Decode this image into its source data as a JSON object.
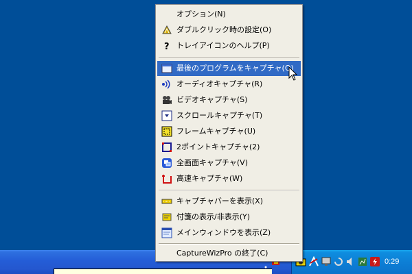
{
  "menu": {
    "items": [
      {
        "label": "オプション(N)",
        "icon": "none"
      },
      {
        "label": "ダブルクリック時の設定(O)",
        "icon": "double-click-icon"
      },
      {
        "label": "トレイアイコンのヘルプ(P)",
        "icon": "help-icon"
      },
      {
        "label": "最後のプログラムをキャプチャ(Q)",
        "icon": "window-icon",
        "highlighted": true
      },
      {
        "label": "オーディオキャプチャ(R)",
        "icon": "audio-icon"
      },
      {
        "label": "ビデオキャプチャ(S)",
        "icon": "video-camera-icon"
      },
      {
        "label": "スクロールキャプチャ(T)",
        "icon": "scroll-capture-icon"
      },
      {
        "label": "フレームキャプチャ(U)",
        "icon": "frame-capture-icon"
      },
      {
        "label": "2ポイントキャプチャ(2)",
        "icon": "two-point-capture-icon"
      },
      {
        "label": "全画面キャプチャ(V)",
        "icon": "fullscreen-capture-icon"
      },
      {
        "label": "高速キャプチャ(W)",
        "icon": "fast-capture-icon"
      },
      {
        "label": "キャプチャバーを表示(X)",
        "icon": "capture-bar-icon"
      },
      {
        "label": "付箋の表示/非表示(Y)",
        "icon": "sticky-note-icon"
      },
      {
        "label": "メインウィンドウを表示(Z)",
        "icon": "main-window-icon"
      },
      {
        "label": "CaptureWizPro の終了(C)",
        "icon": "none"
      }
    ]
  },
  "taskbar": {
    "clock": "0:29"
  },
  "colors": {
    "desktop": "#004e98",
    "menu_bg": "#f0eee5",
    "highlight": "#316ac5",
    "taskbar": "#245dd7",
    "tray": "#0f8ddf"
  }
}
